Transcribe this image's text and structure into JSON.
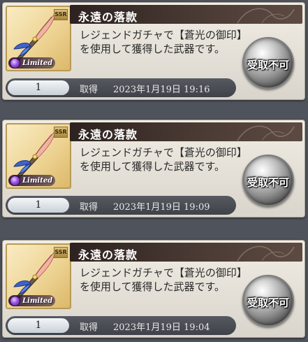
{
  "items": [
    {
      "title": "永遠の落款",
      "rarity": "SSR",
      "badge": "Limited",
      "description": "レジェンドガチャで【蒼光の御印】を使用して獲得した武器です。",
      "quantity": "1",
      "acquired_label": "取得",
      "acquired_date": "2023年1月19日 19:16",
      "button_label": "受取不可"
    },
    {
      "title": "永遠の落款",
      "rarity": "SSR",
      "badge": "Limited",
      "description": "レジェンドガチャで【蒼光の御印】を使用して獲得した武器です。",
      "quantity": "1",
      "acquired_label": "取得",
      "acquired_date": "2023年1月19日 19:09",
      "button_label": "受取不可"
    },
    {
      "title": "永遠の落款",
      "rarity": "SSR",
      "badge": "Limited",
      "description": "レジェンドガチャで【蒼光の御印】を使用して獲得した武器です。",
      "quantity": "1",
      "acquired_label": "取得",
      "acquired_date": "2023年1月19日 19:04",
      "button_label": "受取不可"
    }
  ],
  "colors": {
    "background": "#4f535c",
    "card": "#ece8de",
    "header": "#3b2e2a",
    "thumb": "#eed494",
    "element_dark": "#9b4fe0"
  },
  "icons": {
    "weapon": "quill-weapon-icon",
    "element": "dark-element-icon",
    "decoration": "flourish-ornament"
  }
}
